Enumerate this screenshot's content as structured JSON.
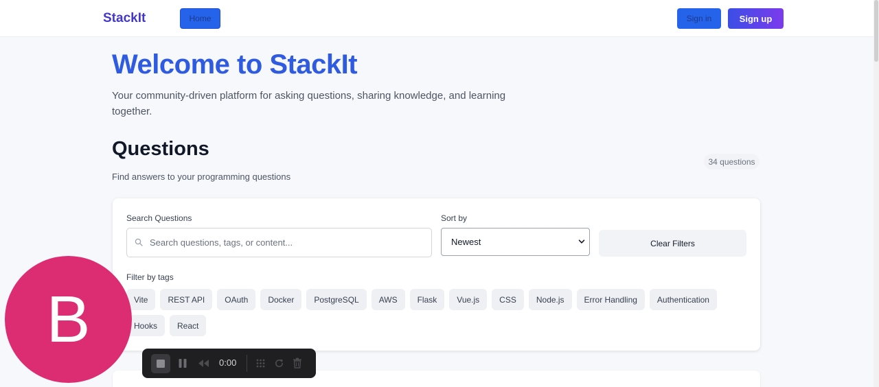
{
  "nav": {
    "brand": "StackIt",
    "home_label": "Home",
    "signin_label": "Sign in",
    "signup_label": "Sign up"
  },
  "hero": {
    "title": "Welcome to StackIt",
    "subtitle": "Your community-driven platform for asking questions, sharing knowledge, and learning together."
  },
  "questions": {
    "title": "Questions",
    "subtitle": "Find answers to your programming questions",
    "count": "34 questions"
  },
  "filters": {
    "search_label": "Search Questions",
    "search_placeholder": "Search questions, tags, or content...",
    "search_value": "",
    "sort_label": "Sort by",
    "sort_value": "Newest",
    "clear_label": "Clear Filters",
    "tags_label": "Filter by tags",
    "tags": [
      "Vite",
      "REST API",
      "OAuth",
      "Docker",
      "PostgreSQL",
      "AWS",
      "Flask",
      "Vue.js",
      "CSS",
      "Node.js",
      "Error Handling",
      "Authentication",
      "Hooks",
      "React"
    ]
  },
  "overlay": {
    "avatar_letter": "B",
    "recorder_time": "0:00"
  },
  "colors": {
    "brand": "#4338ca",
    "hero_title": "#2f5be0",
    "primary_button": "#2563eb",
    "signup_gradient_start": "#3b4ee6",
    "signup_gradient_end": "#7c3aed",
    "avatar": "#dc2c72",
    "recorder_bg": "#1f1f22"
  }
}
